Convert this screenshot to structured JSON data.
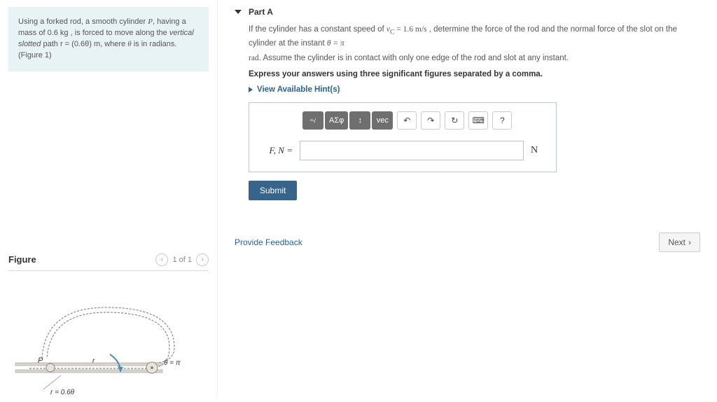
{
  "left": {
    "intro_pre": "Using a forked rod, a smooth cylinder ",
    "intro_varP": "P",
    "intro_mid1": ", having a mass of ",
    "intro_mass": "0.6 kg",
    "intro_mid2": " , is forced to move along the ",
    "intro_slot": "vertical slotted",
    "intro_mid3": " path ",
    "intro_path": "r = (0.6θ) m",
    "intro_mid4": ", where ",
    "intro_theta": "θ",
    "intro_end": " is in radians. (Figure 1)",
    "figure_title": "Figure",
    "figure_counter": "1 of 1",
    "diagram_p": "P",
    "diagram_r": "r",
    "diagram_theta": "θ = π",
    "diagram_req": "r = 0.6θ"
  },
  "right": {
    "part_label": "Part A",
    "q1_pre": "If the cylinder has a constant speed of ",
    "q1_v": "v",
    "q1_c": "C",
    "q1_eq": " = 1.6 m/s",
    "q1_mid": " , determine the force of the rod and the normal force of the slot on the cylinder at the instant ",
    "q1_theta": "θ = π",
    "q2_rad": "rad",
    "q2_rest": ". Assume the cylinder is in contact with only one edge of the rod and slot at any instant.",
    "express": "Express your answers using three significant figures separated by a comma.",
    "hints": "View Available Hint(s)",
    "tb_sqrt": "√",
    "tb_greek": "ΑΣφ",
    "tb_updown": "↕",
    "tb_vec": "vec",
    "tb_undo": "↶",
    "tb_redo": "↷",
    "tb_reset": "↻",
    "tb_kbd": "⌨",
    "tb_help": "?",
    "answer_label": "F, N =",
    "answer_unit": "N",
    "submit": "Submit",
    "feedback": "Provide Feedback",
    "next": "Next"
  }
}
